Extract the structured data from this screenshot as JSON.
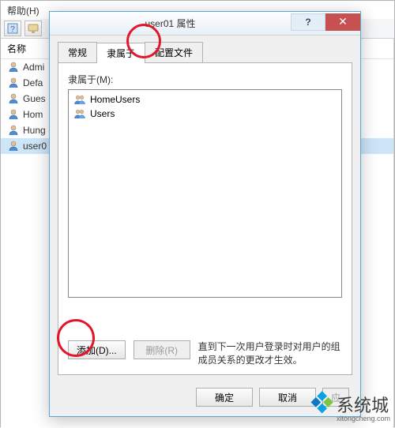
{
  "background": {
    "menu_help": "帮助(H)",
    "column_header": "名称",
    "users": [
      "Admi",
      "Defa",
      "Gues",
      "Hom",
      "Hung",
      "user0"
    ]
  },
  "dialog": {
    "title": "user01 属性",
    "help_btn": "?",
    "close_btn": "✕",
    "tabs": {
      "general": "常规",
      "member_of": "隶属于",
      "profile": "配置文件"
    },
    "member_label": "隶属于(M):",
    "groups": [
      "HomeUsers",
      "Users"
    ],
    "add_btn": "添加(D)...",
    "remove_btn": "删除(R)",
    "note": "直到下一次用户登录时对用户的组成员关系的更改才生效。",
    "ok_btn": "确定",
    "cancel_btn": "取消",
    "apply_btn": "应"
  },
  "watermark": {
    "brand": "系统城",
    "url": "xitongcheng.com"
  }
}
